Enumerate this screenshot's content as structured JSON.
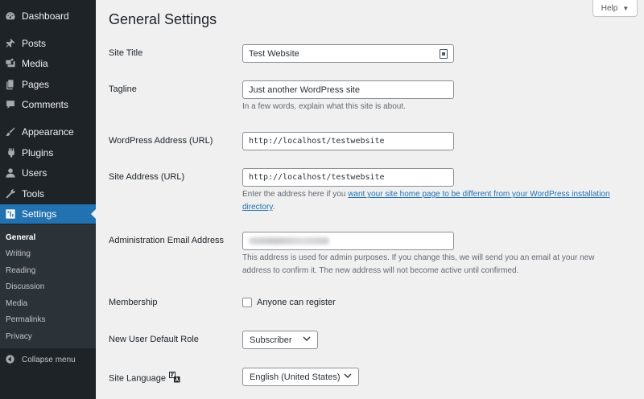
{
  "sidebar": {
    "items": [
      {
        "label": "Dashboard",
        "icon": "dashboard-icon"
      },
      {
        "label": "Posts",
        "icon": "pin-icon"
      },
      {
        "label": "Media",
        "icon": "media-icon"
      },
      {
        "label": "Pages",
        "icon": "pages-icon"
      },
      {
        "label": "Comments",
        "icon": "comment-icon"
      },
      {
        "label": "Appearance",
        "icon": "paintbrush-icon"
      },
      {
        "label": "Plugins",
        "icon": "plugin-icon"
      },
      {
        "label": "Users",
        "icon": "user-icon"
      },
      {
        "label": "Tools",
        "icon": "wrench-icon"
      },
      {
        "label": "Settings",
        "icon": "settings-icon"
      }
    ],
    "submenu": [
      "General",
      "Writing",
      "Reading",
      "Discussion",
      "Media",
      "Permalinks",
      "Privacy"
    ],
    "collapse_label": "Collapse menu",
    "active_color": "#2271b1"
  },
  "header": {
    "title": "General Settings",
    "help_label": "Help"
  },
  "form": {
    "site_title": {
      "label": "Site Title",
      "value": "Test Website"
    },
    "tagline": {
      "label": "Tagline",
      "value": "Just another WordPress site",
      "desc": "In a few words, explain what this site is about."
    },
    "wp_address": {
      "label": "WordPress Address (URL)",
      "value": "http://localhost/testwebsite"
    },
    "site_address": {
      "label": "Site Address (URL)",
      "value": "http://localhost/testwebsite",
      "desc_prefix": "Enter the address here if you ",
      "desc_link_1": "want your site home page to be different from your WordPress installation",
      "desc_link_2": "directory",
      "desc_suffix": "."
    },
    "admin_email": {
      "label": "Administration Email Address",
      "desc_1": "This address is used for admin purposes. If you change this, we will send you an email at your new",
      "desc_2a": "address to confirm it. ",
      "desc_2b": "The new address will not become active until confirmed."
    },
    "membership": {
      "label": "Membership",
      "checkbox_label": "Anyone can register"
    },
    "default_role": {
      "label": "New User Default Role",
      "value": "Subscriber"
    },
    "site_language": {
      "label": "Site Language",
      "value": "English (United States)"
    }
  }
}
